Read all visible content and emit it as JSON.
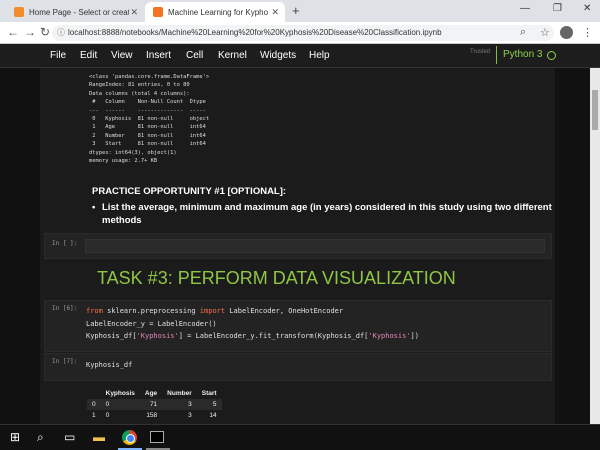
{
  "browser": {
    "tabs": [
      {
        "title": "Home Page - Select or create a n",
        "active": false,
        "fav_color": "#f28b2b"
      },
      {
        "title": "Machine Learning for Kyphosis D",
        "active": true,
        "fav_color": "#f37524"
      }
    ],
    "url": "localhost:8888/notebooks/Machine%20Learning%20for%20Kyphosis%20Disease%20Classification.ipynb",
    "icons": [
      "back-icon",
      "forward-icon",
      "reload-icon",
      "zoom-icon",
      "star-icon",
      "account-icon",
      "more-icon"
    ]
  },
  "jupyter": {
    "menu": [
      "File",
      "Edit",
      "View",
      "Insert",
      "Cell",
      "Kernel",
      "Widgets",
      "Help"
    ],
    "trusted": "Trusted",
    "kernel": "Python 3"
  },
  "cells": {
    "info_output": [
      "<class 'pandas.core.frame.DataFrame'>",
      "RangeIndex: 81 entries, 0 to 80",
      "Data columns (total 4 columns):",
      " #   Column    Non-Null Count  Dtype ",
      "---  ------    --------------  ----- ",
      " 0   Kyphosis  81 non-null     object",
      " 1   Age       81 non-null     int64 ",
      " 2   Number    81 non-null     int64 ",
      " 3   Start     81 non-null     int64 ",
      "dtypes: int64(3), object(1)",
      "memory usage: 2.7+ KB"
    ],
    "practice_heading": "PRACTICE OPPORTUNITY #1 [OPTIONAL]:",
    "practice_bullet": "List the average, minimum and maximum age (in years) considered in this study using two different methods",
    "empty_prompt": "In [ ]:",
    "task_heading": "TASK #3: PERFORM DATA VISUALIZATION",
    "prompt6": "In [6]:",
    "code6_line1_kw1": "from",
    "code6_line1_mid": " sklearn.preprocessing ",
    "code6_line1_kw2": "import",
    "code6_line1_end": " LabelEncoder, OneHotEncoder",
    "code6_line2": "LabelEncoder_y = LabelEncoder()",
    "code6_line3_a": "Kyphosis_df[",
    "code6_line3_s1": "'Kyphosis'",
    "code6_line3_b": "] = LabelEncoder_y.fit_transform(Kyphosis_df[",
    "code6_line3_s2": "'Kyphosis'",
    "code6_line3_c": "])",
    "prompt7": "In [7]:",
    "code7": "Kyphosis_df",
    "df_headers": [
      "",
      "Kyphosis",
      "Age",
      "Number",
      "Start"
    ],
    "df_rows": [
      [
        "0",
        "0",
        "71",
        "3",
        "5"
      ],
      [
        "1",
        "0",
        "158",
        "3",
        "14"
      ]
    ]
  }
}
